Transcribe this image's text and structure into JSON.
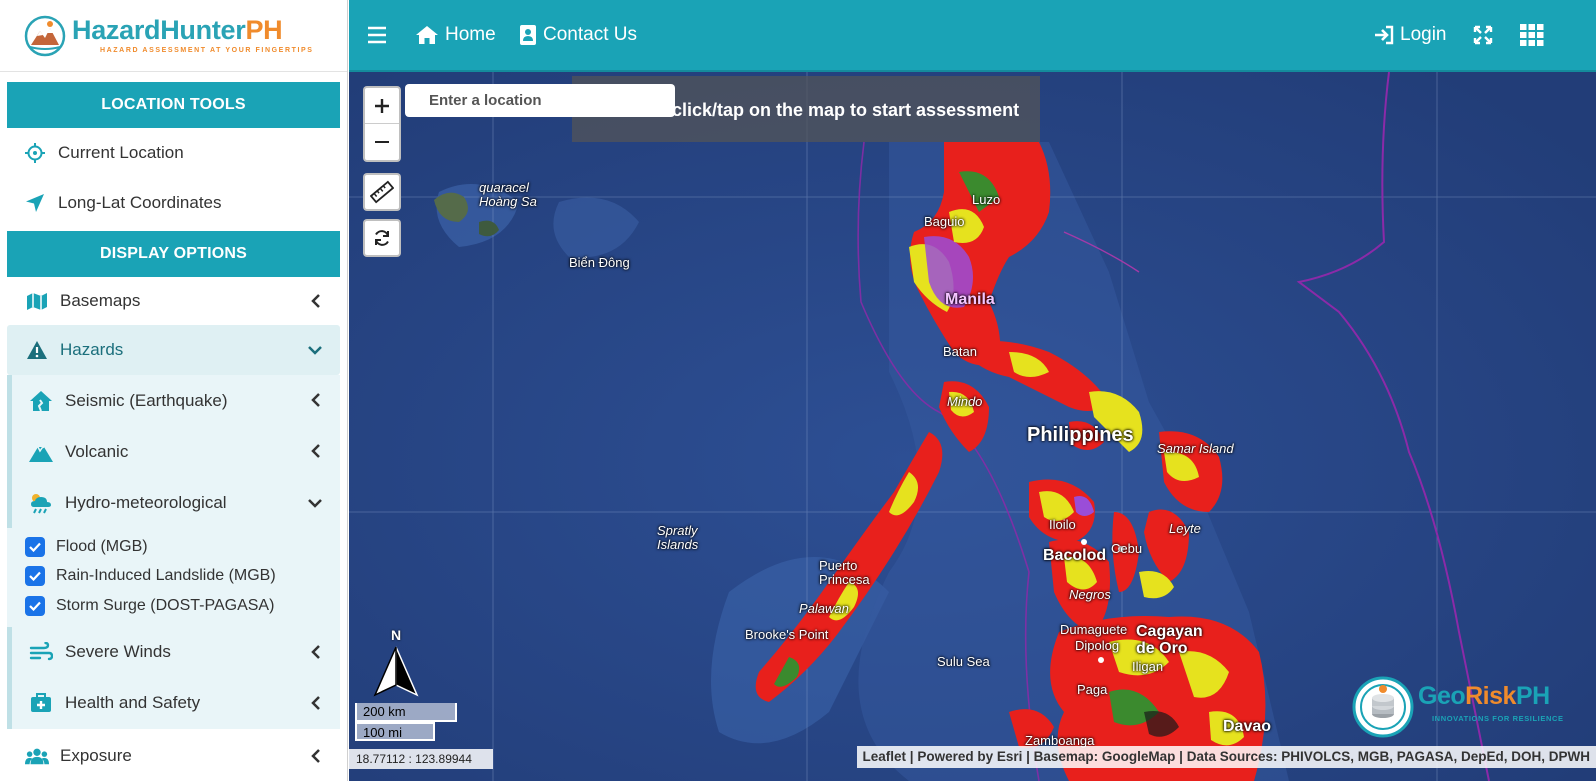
{
  "brand": {
    "name_part1": "Hazard",
    "name_part2": "Hunter",
    "name_part3": "PH",
    "tagline": "HAZARD ASSESSMENT AT YOUR FINGERTIPS"
  },
  "topbar": {
    "home_label": "Home",
    "contact_label": "Contact Us",
    "login_label": "Login"
  },
  "location_tools": {
    "header": "LOCATION TOOLS",
    "items": [
      {
        "label": "Current Location",
        "icon": "crosshair-icon"
      },
      {
        "label": "Long-Lat Coordinates",
        "icon": "location-arrow-icon"
      }
    ]
  },
  "display_options": {
    "header": "DISPLAY OPTIONS",
    "basemaps": "Basemaps",
    "hazards": "Hazards",
    "hazard_groups": [
      {
        "label": "Seismic (Earthquake)",
        "icon": "house-damage-icon",
        "expanded": false
      },
      {
        "label": "Volcanic",
        "icon": "volcano-icon",
        "expanded": false
      },
      {
        "label": "Hydro-meteorological",
        "icon": "cloud-rain-icon",
        "expanded": true
      },
      {
        "label": "Severe Winds",
        "icon": "wind-icon",
        "expanded": false
      },
      {
        "label": "Health and Safety",
        "icon": "medkit-icon",
        "expanded": false
      }
    ],
    "hydromet_layers": [
      {
        "label": "Flood (MGB)",
        "checked": true
      },
      {
        "label": "Rain-Induced Landslide (MGB)",
        "checked": true
      },
      {
        "label": "Storm Surge (DOST-PAGASA)",
        "checked": true
      }
    ],
    "exposure": "Exposure"
  },
  "map": {
    "search_placeholder": "Enter a location",
    "banner": "click/tap on the map to start assessment",
    "labels": {
      "paracel": "quaracel\nHoàng Sa",
      "bien_dong": "Biển Đông",
      "philippines": "Philippines",
      "manila": "Manila",
      "baguio": "Baguio",
      "luzon": "Luzo",
      "batangas": "Batan",
      "mindoro": "Mindo",
      "samar": "Samar Island",
      "spratly": "Spratly\nIslands",
      "puerto_princesa": "Puerto\nPrincesa",
      "palawan": "Palawan",
      "brookes_point": "Brooke's Point",
      "sulu_sea": "Sulu Sea",
      "iloilo": "Iloilo",
      "bacolod": "Bacolod",
      "cebu": "Cebu",
      "leyte": "Leyte",
      "negros": "Negros",
      "dumaguete": "Dumaguete",
      "dipolog": "Dipolog",
      "cagayan": "Cagayan\nde Oro",
      "iligan": "Iligan",
      "pagadian": "Paga",
      "zamboanga": "Zamboanga",
      "davao": "Davao"
    },
    "north_label": "N",
    "scale_km": "200 km",
    "scale_mi": "100 mi",
    "coordinates": "18.77112 : 123.89944",
    "attribution": "Leaflet | Powered by Esri | Basemap: GoogleMap | Data Sources: PHIVOLCS, MGB, PAGASA, DepEd, DOH, DPWH",
    "georisk_name1": "Geo",
    "georisk_name2": "Risk",
    "georisk_name3": "PH",
    "georisk_tag": "INNOVATIONS FOR RESILIENCE"
  },
  "colors": {
    "accent": "#1aa3b6",
    "brand_orange": "#f08b2c",
    "checkbox": "#1a73e8",
    "ocean": "#2b4a8a",
    "hazard_red": "#e8201c",
    "hazard_yellow": "#e6e21e",
    "hazard_purple": "#9a4dd8"
  }
}
